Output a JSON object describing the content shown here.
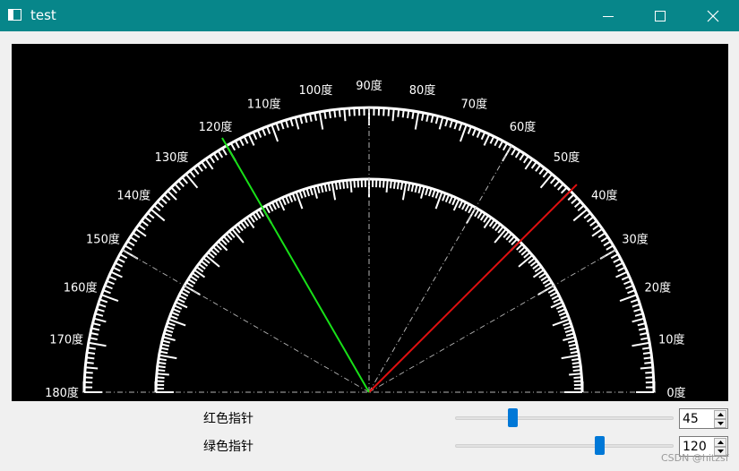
{
  "window": {
    "title": "test",
    "icons": {
      "app": "app-window-icon",
      "minimize": "minimize-icon",
      "maximize": "maximize-icon",
      "close": "close-icon"
    }
  },
  "protractor": {
    "degree_unit": "度",
    "tick_labels": [
      "0度",
      "10度",
      "20度",
      "30度",
      "40度",
      "50度",
      "60度",
      "70度",
      "80度",
      "90度",
      "100度",
      "110度",
      "120度",
      "130度",
      "140度",
      "150度",
      "160度",
      "170度",
      "180度"
    ],
    "pointers": [
      {
        "name": "红色指针",
        "angle": 45,
        "color": "#e01010"
      },
      {
        "name": "绿色指针",
        "angle": 120,
        "color": "#18e018"
      }
    ],
    "colors": {
      "background": "#000000",
      "scale": "#ffffff",
      "guide": "#b4b4b4"
    }
  },
  "controls": {
    "red": {
      "label": "红色指针",
      "value": "45",
      "min": 0,
      "max": 180
    },
    "green": {
      "label": "绿色指针",
      "value": "120",
      "min": 0,
      "max": 180
    }
  },
  "colors": {
    "titlebar": "#07868a",
    "slider_handle": "#0078d7"
  },
  "watermark": "CSDN @hitzsf"
}
